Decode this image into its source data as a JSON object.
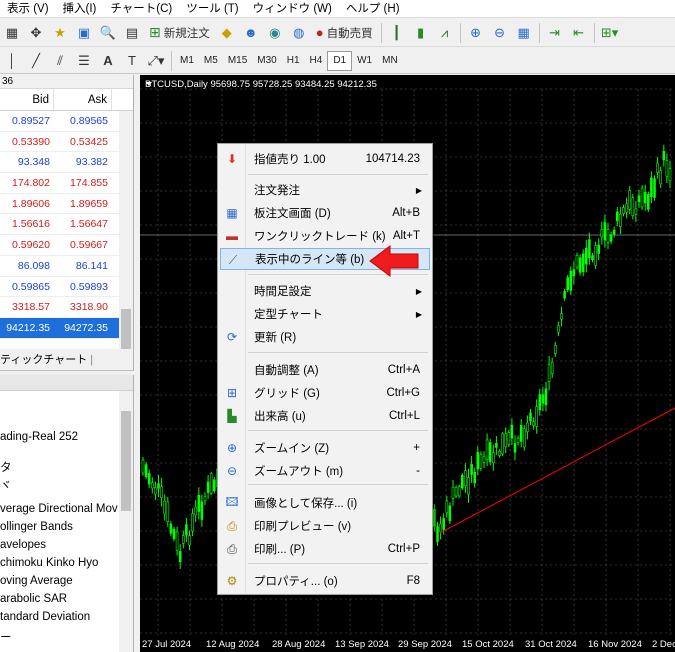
{
  "menubar": [
    "表示 (V)",
    "挿入(I)",
    "チャート(C)",
    "ツール (T)",
    "ウィンドウ (W)",
    "ヘルプ (H)"
  ],
  "toolbar": {
    "new_order": "新規注文",
    "auto_trade": "自動売買"
  },
  "timeframes": [
    "M1",
    "M5",
    "M15",
    "M30",
    "H1",
    "H4",
    "D1",
    "W1",
    "MN"
  ],
  "active_timeframe": "D1",
  "market_watch": {
    "clock": "36",
    "col_bid": "Bid",
    "col_ask": "Ask",
    "rows": [
      {
        "bid": "0.89527",
        "ask": "0.89565",
        "color": "#1a3fd6"
      },
      {
        "bid": "0.53390",
        "ask": "0.53425",
        "color": "#d61a1a"
      },
      {
        "bid": "93.348",
        "ask": "93.382",
        "color": "#1a3fd6"
      },
      {
        "bid": "174.802",
        "ask": "174.855",
        "color": "#d61a1a"
      },
      {
        "bid": "1.89606",
        "ask": "1.89659",
        "color": "#d61a1a"
      },
      {
        "bid": "1.56616",
        "ask": "1.56647",
        "color": "#d61a1a"
      },
      {
        "bid": "0.59620",
        "ask": "0.59667",
        "color": "#d61a1a"
      },
      {
        "bid": "86.098",
        "ask": "86.141",
        "color": "#1a3fd6"
      },
      {
        "bid": "0.59865",
        "ask": "0.59893",
        "color": "#1a3fd6"
      },
      {
        "bid": "3318.57",
        "ask": "3318.90",
        "color": "#d61a1a"
      },
      {
        "bid": "94212.35",
        "ask": "94272.35",
        "color": "#ffffff",
        "selected": true
      }
    ],
    "tab_label": "ティックチャート"
  },
  "navigator": {
    "items": [
      "ading-Real 252",
      "タ",
      "ヾ",
      "verage Directional Mov",
      "ollinger Bands",
      "avelopes",
      "chimoku Kinko Hyo",
      "oving Average",
      "arabolic SAR",
      "tandard Deviation",
      "ー"
    ]
  },
  "chart": {
    "title": "BTCUSD,Daily  95698.75 95728.25 93484.25 94212.35",
    "x_labels": [
      "27 Jul 2024",
      "12 Aug 2024",
      "28 Aug 2024",
      "13 Sep 2024",
      "29 Sep 2024",
      "15 Oct 2024",
      "31 Oct 2024",
      "16 Nov 2024",
      "2 Dec"
    ],
    "colors": {
      "background": "#000000",
      "candle": "#00ff00",
      "trendline": "#ff0000",
      "grid": "#5a5a5a"
    }
  },
  "context_menu": {
    "items": [
      {
        "icon": "sell-limit-icon",
        "label": "指値売り 1.00",
        "shortcut": "104714.23"
      },
      {
        "icon": "",
        "label": "注文発注",
        "shortcut": "",
        "submenu": true
      },
      {
        "icon": "order-board-icon",
        "label": "板注文画面 (D)",
        "shortcut": "Alt+B"
      },
      {
        "icon": "one-click-icon",
        "label": "ワンクリックトレード (k)",
        "shortcut": "Alt+T"
      },
      {
        "icon": "lines-list-icon",
        "label": "表示中のライン等 (b)",
        "shortcut": "",
        "highlighted": true
      },
      {
        "icon": "",
        "label": "時間足設定",
        "shortcut": "",
        "submenu": true
      },
      {
        "icon": "",
        "label": "定型チャート",
        "shortcut": "",
        "submenu": true
      },
      {
        "icon": "refresh-icon",
        "label": "更新 (R)",
        "shortcut": ""
      },
      {
        "icon": "",
        "label": "自動調整 (A)",
        "shortcut": "Ctrl+A"
      },
      {
        "icon": "grid-icon",
        "label": "グリッド (G)",
        "shortcut": "Ctrl+G"
      },
      {
        "icon": "volume-icon",
        "label": "出来高 (u)",
        "shortcut": "Ctrl+L"
      },
      {
        "icon": "zoom-in-icon",
        "label": "ズームイン (Z)",
        "shortcut": "+"
      },
      {
        "icon": "zoom-out-icon",
        "label": "ズームアウト (m)",
        "shortcut": "-"
      },
      {
        "icon": "save-image-icon",
        "label": "画像として保存... (i)",
        "shortcut": ""
      },
      {
        "icon": "print-preview-icon",
        "label": "印刷プレビュー (v)",
        "shortcut": ""
      },
      {
        "icon": "print-icon",
        "label": "印刷... (P)",
        "shortcut": "Ctrl+P"
      },
      {
        "icon": "properties-icon",
        "label": "プロパティ... (o)",
        "shortcut": "F8"
      }
    ]
  }
}
